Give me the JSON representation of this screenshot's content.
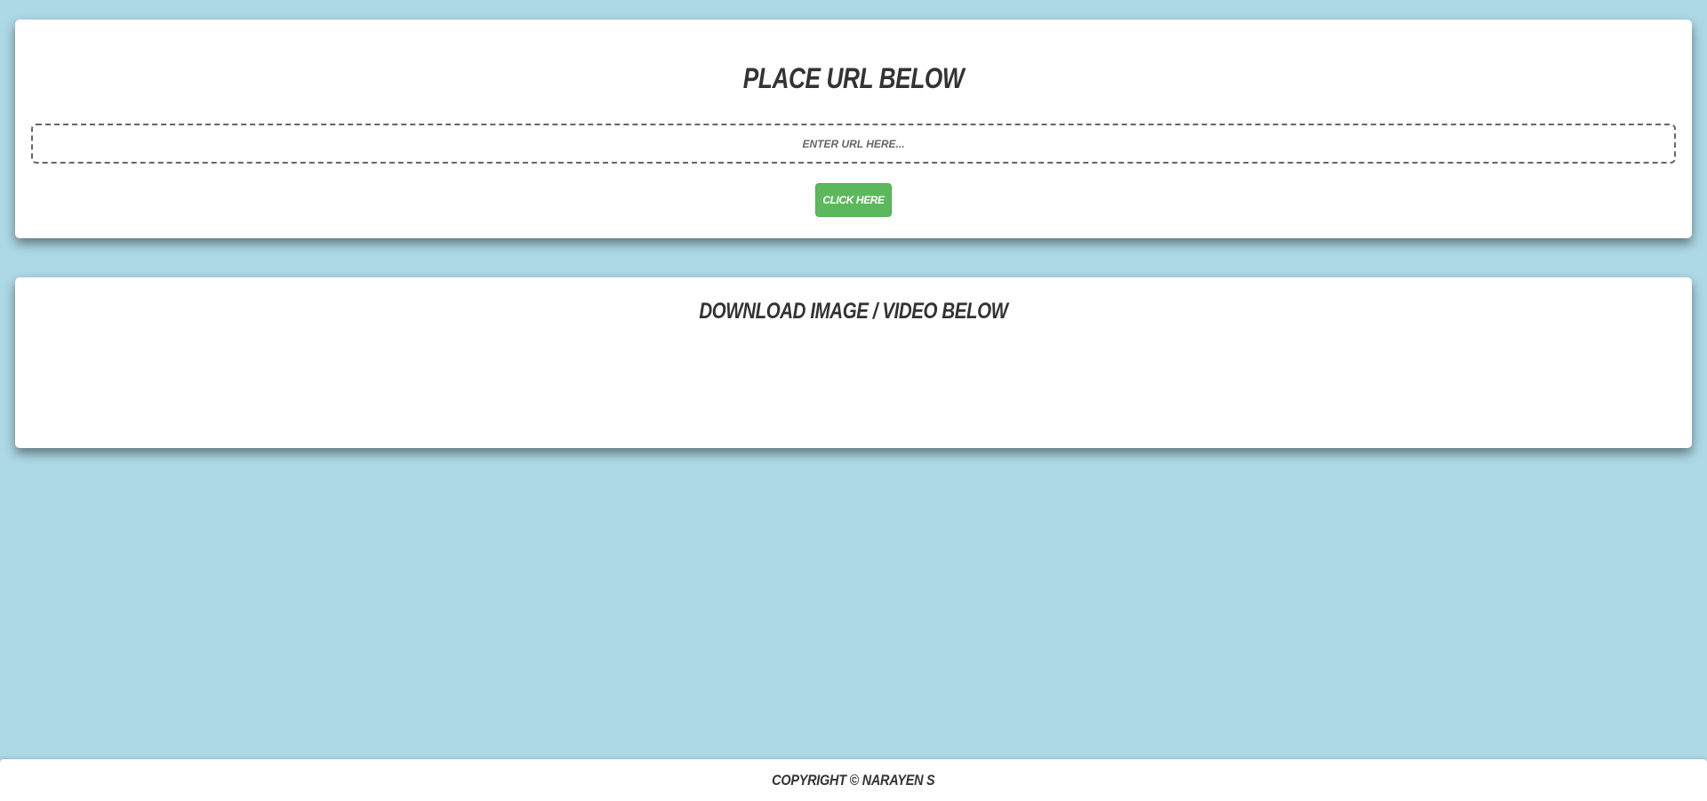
{
  "url_section": {
    "title": "Place URL Below",
    "input_placeholder": "Enter URL here...",
    "input_value": "",
    "button_label": "Click Here"
  },
  "download_section": {
    "title": "Download Image / Video Below"
  },
  "footer": {
    "copyright": "Copyright © Narayen S"
  },
  "colors": {
    "background": "#add8e6",
    "card": "#ffffff",
    "button": "#5cb85c",
    "text": "#333333"
  }
}
